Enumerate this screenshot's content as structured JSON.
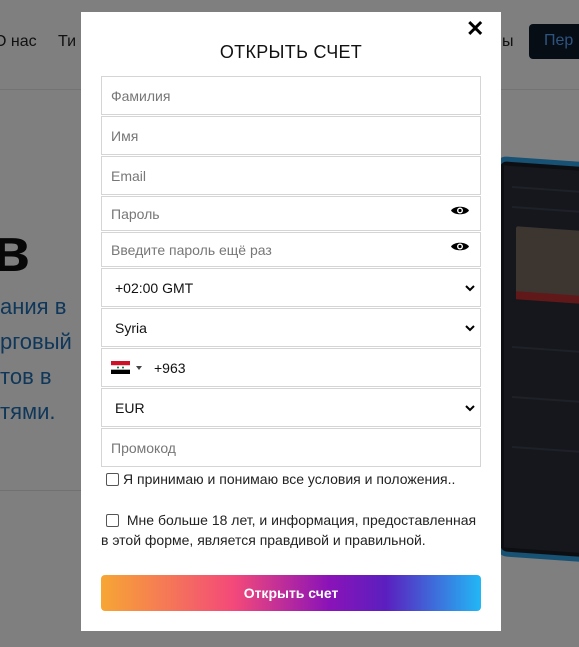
{
  "background": {
    "nav": {
      "item1": "О нас",
      "item2": "Ти",
      "item3": "ы",
      "cta": "Пер"
    },
    "hero": {
      "big": "в",
      "lines": [
        "ания в",
        "рговый",
        "тов в",
        "тями."
      ]
    }
  },
  "modal": {
    "title": "ОТКРЫТЬ СЧЕТ",
    "close_icon": "close-icon",
    "fields": {
      "last_name_placeholder": "Фамилия",
      "first_name_placeholder": "Имя",
      "email_placeholder": "Email",
      "password_placeholder": "Пароль",
      "password_repeat_placeholder": "Введите пароль ещё раз",
      "timezone_value": "+02:00 GMT",
      "country_value": "Syria",
      "phone_code": "+963",
      "currency_value": "EUR",
      "promo_placeholder": "Промокод"
    },
    "checks": {
      "terms": "Я принимаю и понимаю все условия и положения..",
      "age": "Мне больше 18 лет, и информация, предоставленная в этой форме, является правдивой и правильной."
    },
    "submit_label": "Открыть счет"
  },
  "colors": {
    "overlay": "rgba(0,0,0,0.5)",
    "gradient": [
      "#f7a634",
      "#f3497a",
      "#8a13b8",
      "#22b7f5"
    ],
    "flag": [
      "#ce1126",
      "#ffffff",
      "#000000",
      "#007a3d"
    ]
  }
}
